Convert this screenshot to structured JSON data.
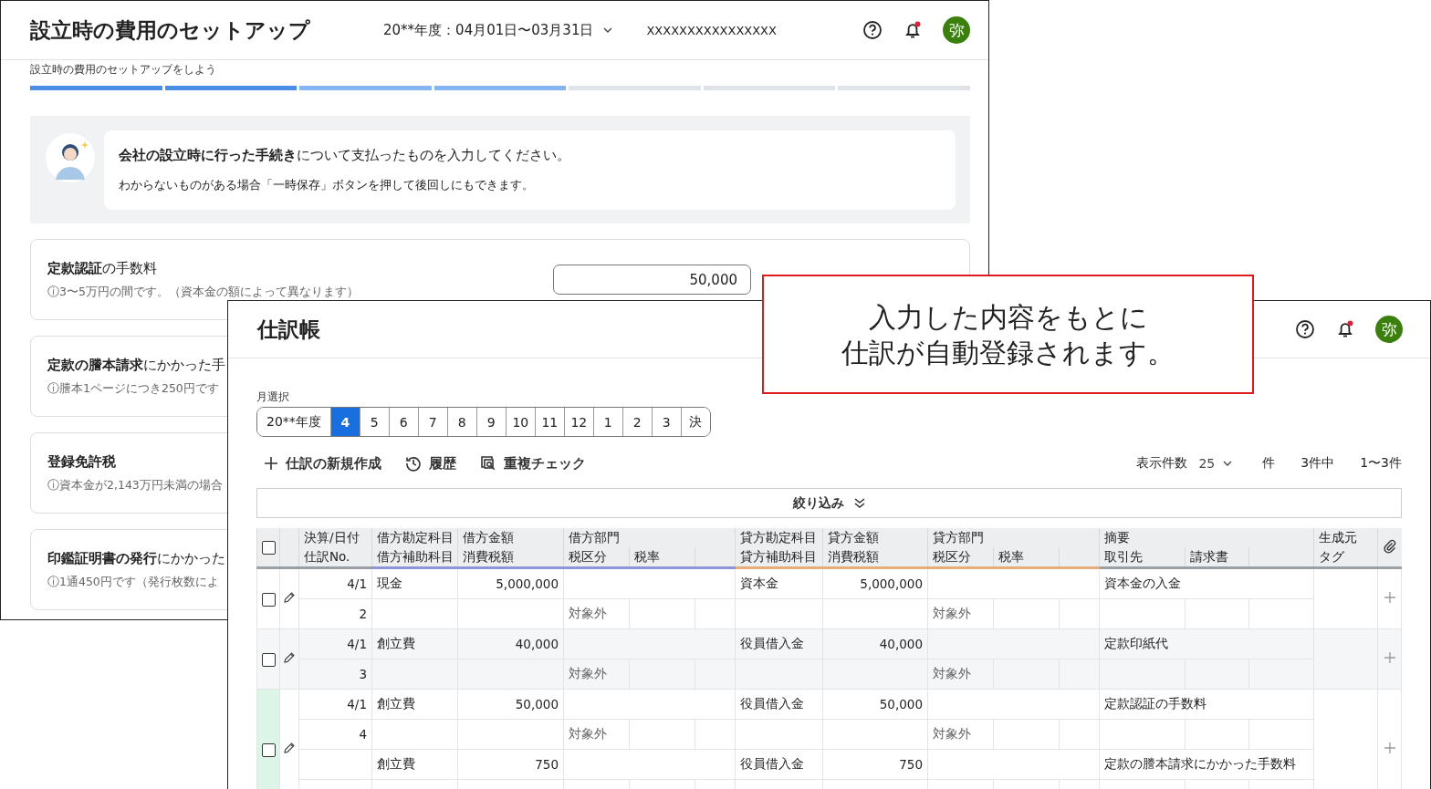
{
  "setup_window": {
    "title": "設立時の費用のセットアップ",
    "period": "20**年度：04月01日〜03月31日",
    "company": "XXXXXXXXXXXXXXXX",
    "avatar": "弥",
    "has_notification": true,
    "subtitle": "設立時の費用のセットアップをしよう",
    "steps": [
      {
        "kind": "complete"
      },
      {
        "kind": "complete"
      },
      {
        "kind": "current"
      },
      {
        "kind": "current"
      },
      {
        "kind": "pending"
      },
      {
        "kind": "pending"
      },
      {
        "kind": "pending"
      }
    ],
    "notice": {
      "lines": [
        "**会社の設立時に行った手続き**について支払ったものを入力してください。",
        "わからないものがある場合「一時保存」ボタンを押して後回しにもできます。"
      ]
    },
    "cards": [
      {
        "title": "**定款認証**の手数料",
        "title_bold": false,
        "hint": "ⓘ3〜5万円の間です。（資本金の額によって異なります）",
        "value": "50,000"
      },
      {
        "title": "**定款の謄本請求**にかかった手",
        "title_bold": false,
        "hint": "ⓘ謄本1ページにつき250円です"
      },
      {
        "title": "登録免許税",
        "title_bold": true,
        "hint": "ⓘ資本金が2,143万円未満の場合"
      },
      {
        "title": "**印鑑証明書の発行**にかかった",
        "title_bold": false,
        "hint": "ⓘ1通450円です（発行枚数によ"
      }
    ]
  },
  "journal_window": {
    "title": "仕訳帳",
    "avatar": "弥",
    "has_notification": true,
    "month_label": "月選択",
    "months": [
      {
        "label": "20**年度",
        "selected": false
      },
      {
        "label": "4",
        "selected": true
      },
      {
        "label": "5",
        "selected": false
      },
      {
        "label": "6",
        "selected": false
      },
      {
        "label": "7",
        "selected": false
      },
      {
        "label": "8",
        "selected": false
      },
      {
        "label": "9",
        "selected": false
      },
      {
        "label": "10",
        "selected": false
      },
      {
        "label": "11",
        "selected": false
      },
      {
        "label": "12",
        "selected": false
      },
      {
        "label": "1",
        "selected": false
      },
      {
        "label": "2",
        "selected": false
      },
      {
        "label": "3",
        "selected": false
      },
      {
        "label": "決",
        "selected": false
      }
    ],
    "actions": [
      {
        "kind": "add",
        "label": "仕訳の新規作成"
      },
      {
        "kind": "history",
        "label": "履歴"
      },
      {
        "kind": "duplicate",
        "label": "重複チェック"
      }
    ],
    "page_size_label": "表示件数",
    "page_size": "25",
    "unit": "件",
    "total": "3件中",
    "range": "1〜3件",
    "filter": "絞り込み",
    "table": {
      "all_checked": false,
      "header": {
        "date": "決算/日付",
        "number": "仕訳No.",
        "debit_account": "借方勘定科目",
        "debit_sub_account": "借方補助科目",
        "debit_amount": "借方金額",
        "debit_tax": "消費税額",
        "debit_department": "借方部門",
        "debit_tax_class": "税区分",
        "debit_tax_rate": "税率",
        "credit_account": "貸方勘定科目",
        "credit_sub_account": "貸方補助科目",
        "credit_amount": "貸方金額",
        "credit_tax": "消費税額",
        "credit_department": "貸方部門",
        "credit_tax_class": "税区分",
        "credit_tax_rate": "税率",
        "description": "摘要",
        "partner": "取引先",
        "invoice": "請求書",
        "source": "生成元",
        "tag": "タグ"
      },
      "entries": [
        {
          "checked": false,
          "highlighted": false,
          "date": "4/1",
          "number": "2",
          "lines": [
            {
              "debit_account": "現金",
              "debit_amount": "5,000,000",
              "debit_tax_class": "対象外",
              "credit_account": "資本金",
              "credit_amount": "5,000,000",
              "credit_tax_class": "対象外",
              "description": "資本金の入金"
            }
          ]
        },
        {
          "checked": false,
          "highlighted": false,
          "date": "4/1",
          "number": "3",
          "lines": [
            {
              "debit_account": "創立費",
              "debit_amount": "40,000",
              "debit_tax_class": "対象外",
              "credit_account": "役員借入金",
              "credit_amount": "40,000",
              "credit_tax_class": "対象外",
              "description": "定款印紙代"
            }
          ]
        },
        {
          "checked": false,
          "highlighted": true,
          "date": "4/1",
          "number": "4",
          "lines": [
            {
              "debit_account": "創立費",
              "debit_amount": "50,000",
              "debit_tax_class": "対象外",
              "credit_account": "役員借入金",
              "credit_amount": "50,000",
              "credit_tax_class": "対象外",
              "description": "定款認証の手数料"
            },
            {
              "debit_account": "創立費",
              "debit_amount": "750",
              "credit_account": "役員借入金",
              "credit_amount": "750",
              "description": "定款の謄本請求にかかった手数料"
            }
          ]
        }
      ]
    }
  },
  "callout": {
    "lines": [
      "入力した内容をもとに",
      "仕訳が自動登録されます。"
    ]
  }
}
